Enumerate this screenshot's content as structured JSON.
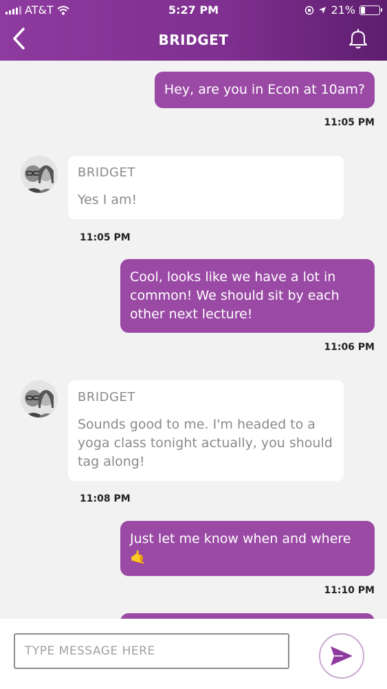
{
  "status_bar": {
    "carrier": "AT&T",
    "time": "5:27 PM",
    "battery": "21%",
    "battery_level": 0.21
  },
  "header": {
    "title": "BRIDGET",
    "back_icon": "chevron-left-icon",
    "bell_icon": "bell-icon"
  },
  "messages": [
    {
      "direction": "outgoing",
      "text": "Hey, are you in Econ at 10am?",
      "time": "11:05 PM"
    },
    {
      "direction": "incoming",
      "sender": "BRIDGET",
      "text": "Yes I am!",
      "time": "11:05 PM"
    },
    {
      "direction": "outgoing",
      "text": "Cool, looks like we have a lot in common! We should sit by each other next lecture!",
      "time": "11:06 PM"
    },
    {
      "direction": "incoming",
      "sender": "BRIDGET",
      "text": "Sounds good to me. I'm headed to a yoga class tonight actually, you should tag along!",
      "time": "11:08 PM"
    },
    {
      "direction": "outgoing",
      "text": "Just let me know when and where 🤙",
      "time": "11:10 PM"
    }
  ],
  "compose": {
    "placeholder": "TYPE MESSAGE HERE",
    "send_icon": "send-icon"
  },
  "colors": {
    "brand": "#8e3a9f",
    "bubble_out": "#9a4aa5",
    "bubble_in": "#ffffff",
    "background": "#f2f2f2"
  }
}
